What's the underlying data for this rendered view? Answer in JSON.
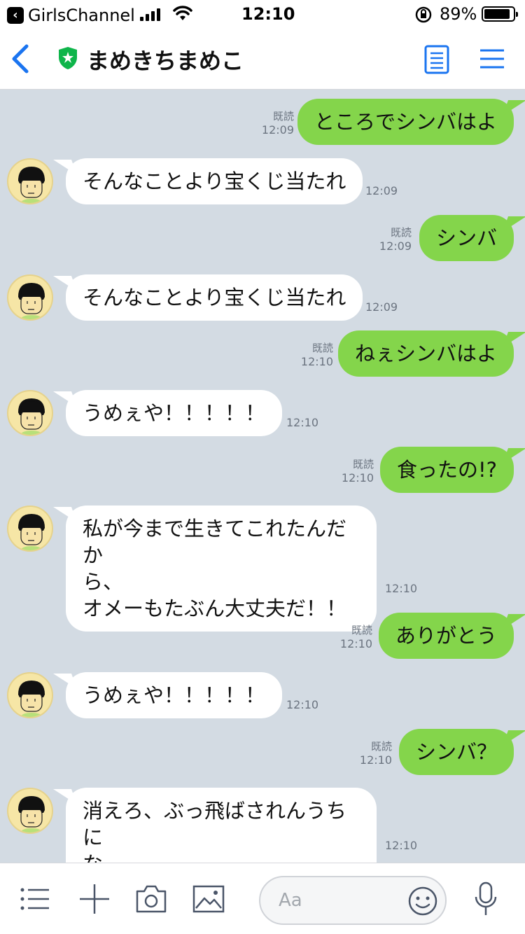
{
  "status_bar": {
    "app_back": "GirlsChannel",
    "time": "12:10",
    "battery_percent": "89%",
    "battery_level": 0.89
  },
  "header": {
    "title": "まめきちまめこ",
    "accent_color": "#1a74f0",
    "official_badge_color": "#0eb54a"
  },
  "colors": {
    "chat_background": "#d3dbe3",
    "outgoing_bubble": "#84d54b",
    "incoming_bubble": "#ffffff"
  },
  "messages": [
    {
      "dir": "out",
      "text": "ところでシンバはよ",
      "read": "既読",
      "time": "12:09"
    },
    {
      "dir": "in",
      "text": "そんなことより宝くじ当たれ",
      "time": "12:09"
    },
    {
      "dir": "out",
      "text": "シンバ",
      "read": "既読",
      "time": "12:09"
    },
    {
      "dir": "in",
      "text": "そんなことより宝くじ当たれ",
      "time": "12:09"
    },
    {
      "dir": "out",
      "text": "ねぇシンバはよ",
      "read": "既読",
      "time": "12:10"
    },
    {
      "dir": "in",
      "text": "うめぇや！！！！！",
      "time": "12:10"
    },
    {
      "dir": "out",
      "text": "食ったの!?",
      "read": "既読",
      "time": "12:10"
    },
    {
      "dir": "in",
      "lines": [
        "私が今まで生きてこれたんだか",
        "ら、",
        "オメーもたぶん大丈夫だ！！"
      ],
      "time": "12:10"
    },
    {
      "dir": "out",
      "text": "ありがとう",
      "read": "既読",
      "time": "12:10"
    },
    {
      "dir": "in",
      "text": "うめぇや！！！！！",
      "time": "12:10"
    },
    {
      "dir": "out",
      "text": "シンバ？",
      "read": "既読",
      "time": "12:10"
    },
    {
      "dir": "in",
      "lines": [
        "消えろ、ぶっ飛ばされんうちに",
        "な"
      ],
      "time": "12:10"
    }
  ],
  "input_bar": {
    "placeholder": "Aa",
    "icons": [
      "list-icon",
      "plus-icon",
      "camera-icon",
      "image-icon",
      "emoji-icon",
      "microphone-icon"
    ]
  }
}
